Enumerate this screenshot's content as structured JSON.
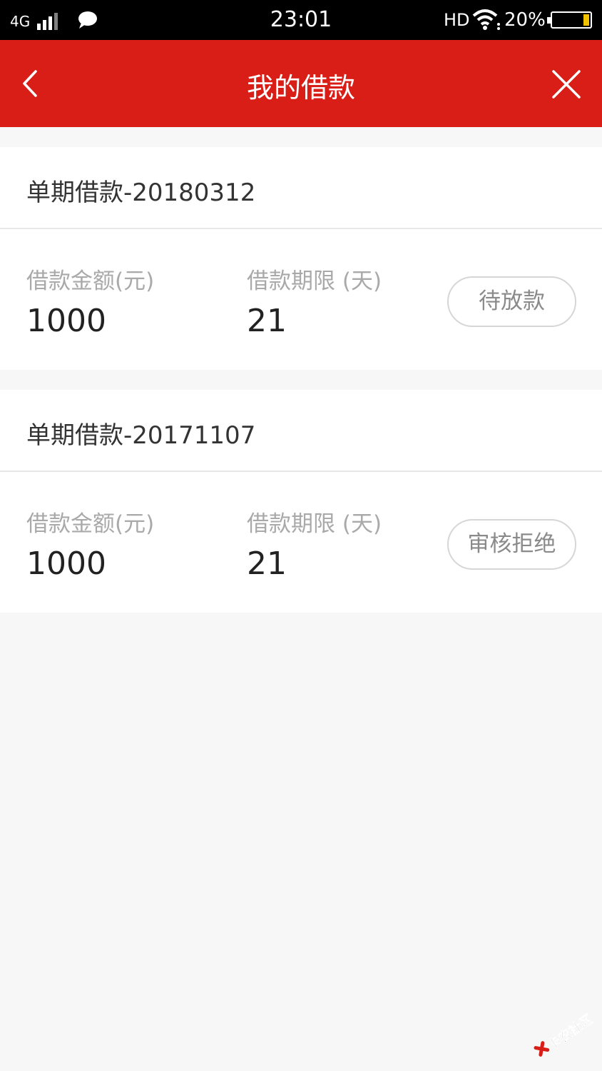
{
  "status_bar": {
    "network": "4G",
    "time": "23:01",
    "hd": "HD",
    "battery_percent": "20%",
    "battery_level": 0.2
  },
  "header": {
    "title": "我的借款",
    "background_color": "#d81e17",
    "back_icon": "chevron-left-icon",
    "close_icon": "close-icon"
  },
  "loans": [
    {
      "title": "单期借款-20180312",
      "amount_label": "借款金额(元)",
      "amount": "1000",
      "term_label": "借款期限 (天)",
      "term": "21",
      "status": "待放款"
    },
    {
      "title": "单期借款-20171107",
      "amount_label": "借款金额(元)",
      "amount": "1000",
      "term_label": "借款期限 (天)",
      "term": "21",
      "status": "审核拒绝"
    }
  ],
  "watermark": {
    "text": "卡农社区"
  }
}
